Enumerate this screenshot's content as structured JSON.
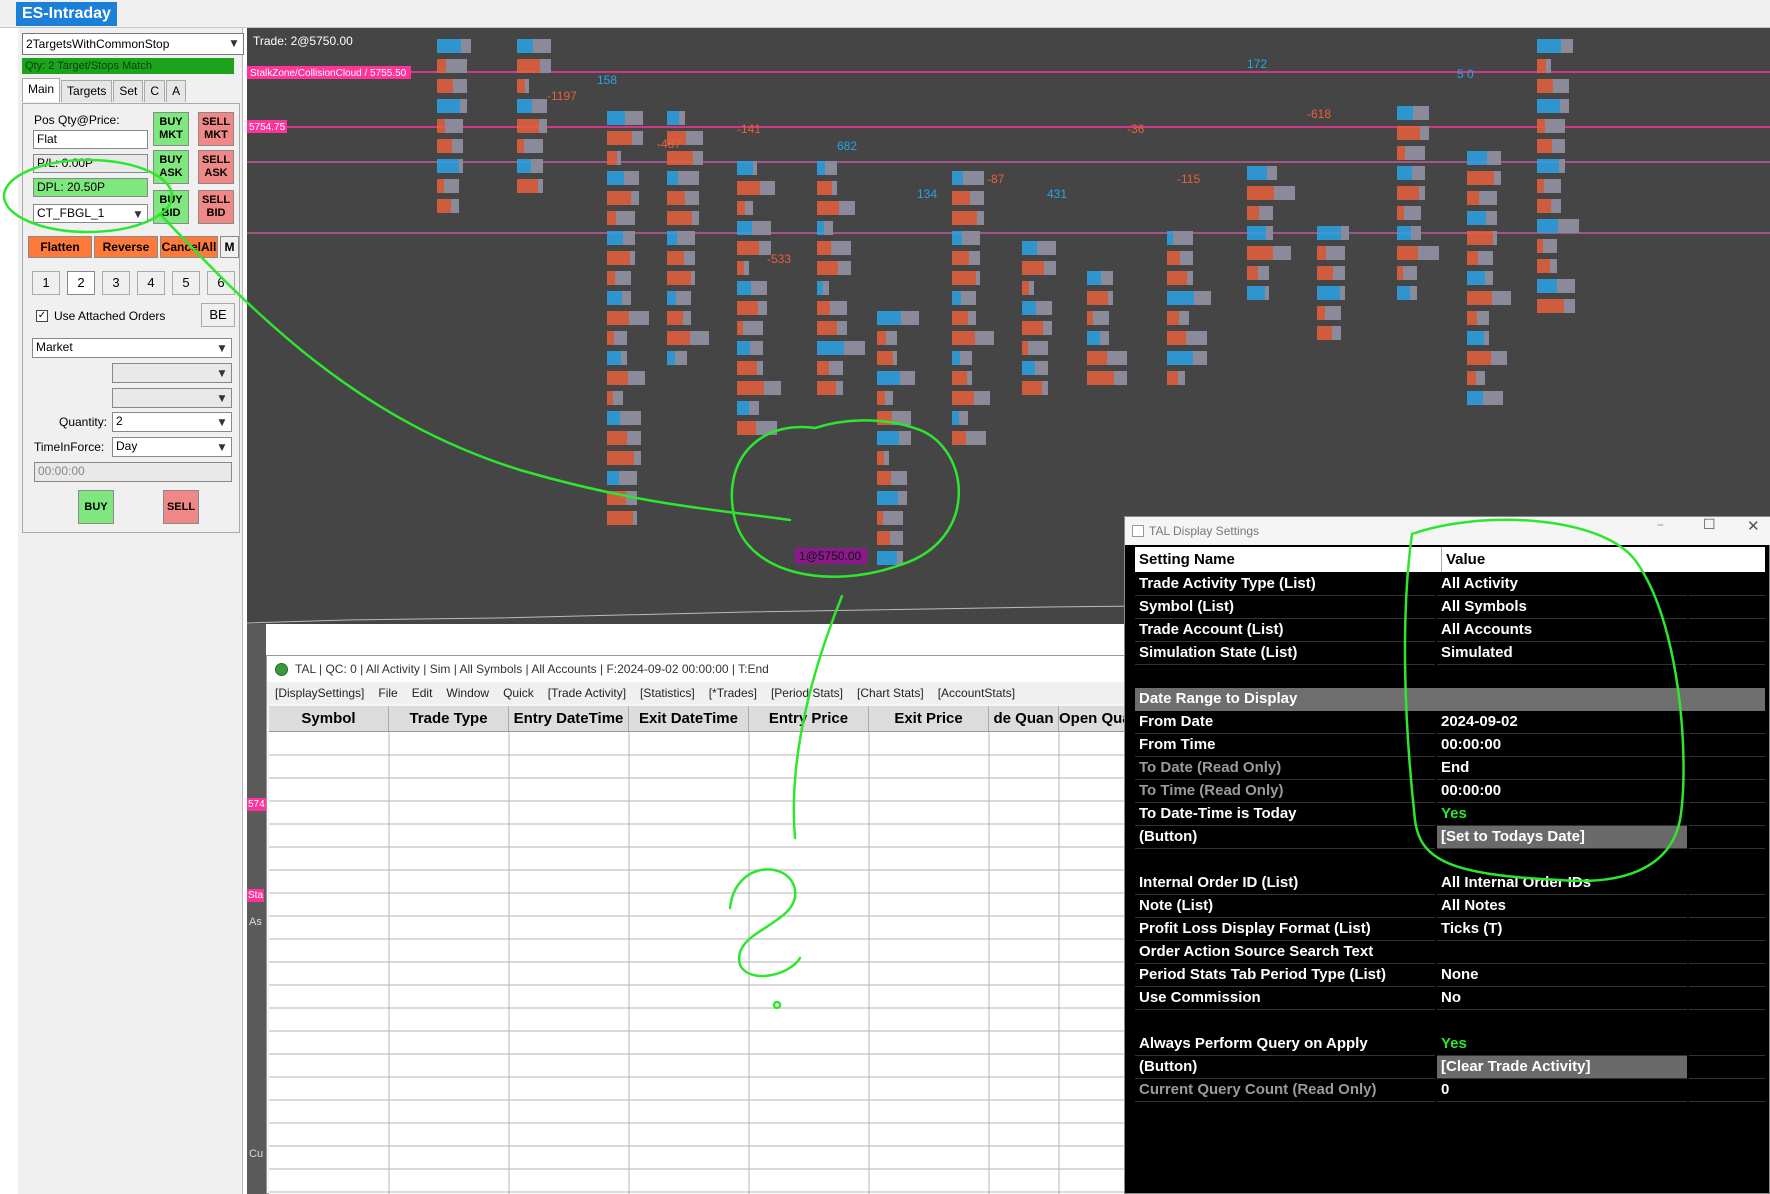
{
  "app": {
    "title": "ES-Intraday"
  },
  "trade_window": {
    "strategy": "2TargetsWithCommonStop",
    "qty_status": "Qty: 2 Target/Stops Match",
    "tabs": [
      "Main",
      "Targets",
      "Set",
      "C",
      "A"
    ],
    "pos_label": "Pos Qty@Price:",
    "pos_value": "Flat",
    "pl": "P/L: 0.00P",
    "dpl": "DPL: 20.50P",
    "account": "CT_FBGL_1",
    "buy_mkt": "BUY MKT",
    "sell_mkt": "SELL MKT",
    "buy_ask": "BUY ASK",
    "sell_ask": "SELL ASK",
    "buy_bid": "BUY BID",
    "sell_bid": "SELL BID",
    "flatten": "Flatten",
    "reverse": "Reverse",
    "cancel_all": "CancelAll",
    "m": "M",
    "numbers": [
      "1",
      "2",
      "3",
      "4",
      "5",
      "6"
    ],
    "use_attached": "Use Attached Orders",
    "be": "BE",
    "order_type": "Market",
    "quantity_label": "Quantity:",
    "quantity": "2",
    "tif_label": "TimeInForce:",
    "tif": "Day",
    "time": "00:00:00",
    "buy": "BUY",
    "sell": "SELL"
  },
  "chart": {
    "trade_label": "Trade: 2@5750.00",
    "stalkzone": "StalkZone/CollisionCloud / 5755.50",
    "price_tag": "5754.75",
    "fill_marker": "1@5750.00",
    "deltas": [
      "-1197",
      "158",
      "-487",
      "-141",
      "682",
      "-533",
      "134",
      "-87",
      "431",
      "-36",
      "-115",
      "172",
      "-618",
      "5 0"
    ],
    "left_edge_tags": [
      "574",
      "Sta",
      "As",
      "Cu"
    ],
    "colors": {
      "bg": "#454545",
      "sell": "#e8603c",
      "buy": "#2aa3e8",
      "line": "#ff66cc",
      "green_annot": "#2ee62e"
    }
  },
  "tal": {
    "title": "TAL | QC: 0 | All Activity | Sim | All Symbols | All Accounts | F:2024-09-02  00:00:00 | T:End",
    "menu": [
      "[DisplaySettings]",
      "File",
      "Edit",
      "Window",
      "Quick",
      "[Trade Activity]",
      "[Statistics]",
      "[*Trades]",
      "[Period Stats]",
      "[Chart Stats]",
      "[AccountStats]"
    ],
    "columns": [
      "Symbol",
      "Trade Type",
      "Entry DateTime",
      "Exit DateTime",
      "Entry Price",
      "Exit Price",
      "de Quan",
      "Open Qua"
    ]
  },
  "settings": {
    "title": "TAL Display Settings",
    "header": {
      "name": "Setting Name",
      "value": "Value"
    },
    "group1": [
      {
        "name": "Trade Activity Type (List)",
        "value": "All Activity"
      },
      {
        "name": "Symbol (List)",
        "value": "All Symbols"
      },
      {
        "name": "Trade Account (List)",
        "value": "All Accounts"
      },
      {
        "name": "Simulation State (List)",
        "value": "Simulated"
      }
    ],
    "section": "Date Range to Display",
    "group2": [
      {
        "name": "From Date",
        "value": "2024-09-02"
      },
      {
        "name": "From Time",
        "value": "00:00:00"
      },
      {
        "name": "To Date (Read Only)",
        "value": "End"
      },
      {
        "name": "To Time (Read Only)",
        "value": "00:00:00"
      },
      {
        "name": "To Date-Time is Today",
        "value": "Yes"
      },
      {
        "name": " (Button)",
        "value": "[Set to Todays Date]"
      }
    ],
    "group3": [
      {
        "name": "Internal Order ID (List)",
        "value": "All Internal Order IDs"
      },
      {
        "name": "Note (List)",
        "value": "All Notes"
      },
      {
        "name": "Profit Loss Display Format (List)",
        "value": "Ticks (T)"
      },
      {
        "name": "Order Action Source Search Text",
        "value": ""
      },
      {
        "name": "Period Stats Tab Period Type (List)",
        "value": "None"
      },
      {
        "name": "Use Commission",
        "value": "No"
      }
    ],
    "group4": [
      {
        "name": "Always Perform Query on Apply",
        "value": "Yes"
      },
      {
        "name": " (Button)",
        "value": "[Clear Trade Activity]"
      },
      {
        "name": "Current Query Count (Read Only)",
        "value": "0"
      }
    ]
  }
}
